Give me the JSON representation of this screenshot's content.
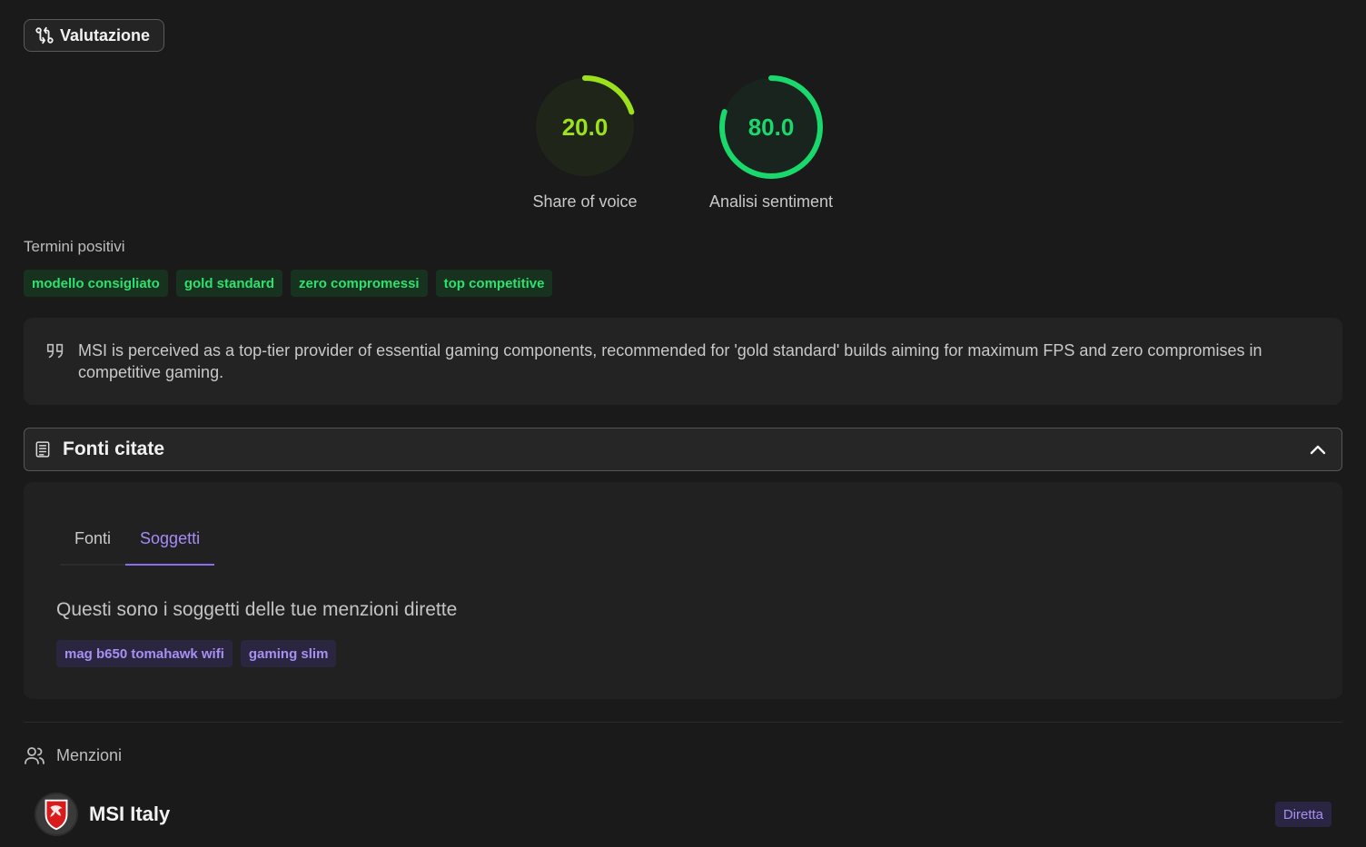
{
  "header": {
    "badge_label": "Valutazione",
    "badge_icon": "git-compare-icon"
  },
  "gauges": [
    {
      "value": "20.0",
      "percent": 20,
      "label": "Share of voice",
      "color": "#9be21c"
    },
    {
      "value": "80.0",
      "percent": 80,
      "label": "Analisi sentiment",
      "color": "#19d86c"
    }
  ],
  "positive_terms": {
    "label": "Termini positivi",
    "tags": [
      "modello consigliato",
      "gold standard",
      "zero compromessi",
      "top competitive"
    ]
  },
  "quote": {
    "text": "MSI is perceived as a top-tier provider of essential gaming components, recommended for 'gold standard' builds aiming for maximum FPS and zero compromises in competitive gaming."
  },
  "sources_accordion": {
    "title": "Fonti citate",
    "expanded": true
  },
  "sources_tabs": {
    "tabs": [
      "Fonti",
      "Soggetti"
    ],
    "active": "Soggetti",
    "description": "Questi sono i soggetti delle tue menzioni dirette",
    "subjects": [
      "mag b650 tomahawk wifi",
      "gaming slim"
    ]
  },
  "mentions": {
    "label": "Menzioni",
    "items": [
      {
        "name": "MSI Italy",
        "type": "Diretta"
      }
    ]
  },
  "colors": {
    "accent_green": "#2ee06e",
    "accent_purple": "#a88ff2",
    "background": "#1a1a1a"
  }
}
